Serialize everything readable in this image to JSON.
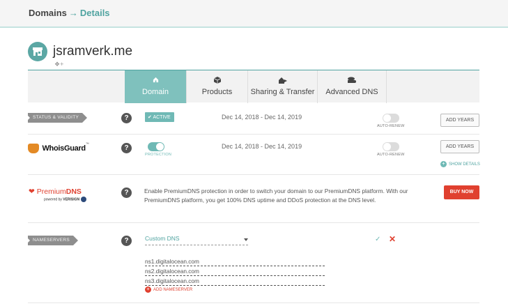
{
  "breadcrumb": {
    "parent": "Domains",
    "separator": "→",
    "current": "Details"
  },
  "domain": {
    "name": "jsramverk.me"
  },
  "tabs": [
    {
      "label": "Domain",
      "icon": "home-icon",
      "active": true
    },
    {
      "label": "Products",
      "icon": "box-icon",
      "active": false
    },
    {
      "label": "Sharing & Transfer",
      "icon": "share-icon",
      "active": false
    },
    {
      "label": "Advanced DNS",
      "icon": "dns-icon",
      "active": false
    }
  ],
  "status": {
    "label": "STATUS & VALIDITY",
    "help": "?",
    "badge": "ACTIVE",
    "dates": "Dec 14, 2018 - Dec 14, 2019",
    "autorenew_label": "AUTO-RENEW",
    "autorenew_on": false,
    "button": "ADD YEARS"
  },
  "whoisguard": {
    "logo_text": "WhoisGuard",
    "logo_tm": "™",
    "help": "?",
    "protection_label": "PROTECTION",
    "protection_on": true,
    "dates": "Dec 14, 2018 - Dec 14, 2019",
    "autorenew_label": "AUTO-RENEW",
    "autorenew_on": false,
    "button": "ADD YEARS",
    "show_details": "SHOW DETAILS",
    "show_details_icon": "+"
  },
  "premiumdns": {
    "logo_premium": "Premium",
    "logo_dns": "DNS",
    "powered_by": "powered by",
    "verisign": "VERISIGN",
    "help": "?",
    "description": "Enable PremiumDNS protection in order to switch your domain to our PremiumDNS platform. With our PremiumDNS platform, you get 100% DNS uptime and DDoS protection at the DNS level.",
    "button": "BUY NOW"
  },
  "nameservers": {
    "label": "NAMESERVERS",
    "help": "?",
    "selected": "Custom DNS",
    "confirm": "✓",
    "cancel": "✕",
    "servers": [
      "ns1.digitalocean.com",
      "ns2.digitalocean.com",
      "ns3.digitalocean.com"
    ],
    "add_label": "ADD NAMESERVER",
    "add_icon": "+"
  },
  "colors": {
    "teal": "#6fb9b5",
    "red": "#e0402f",
    "orange": "#e38a25"
  }
}
